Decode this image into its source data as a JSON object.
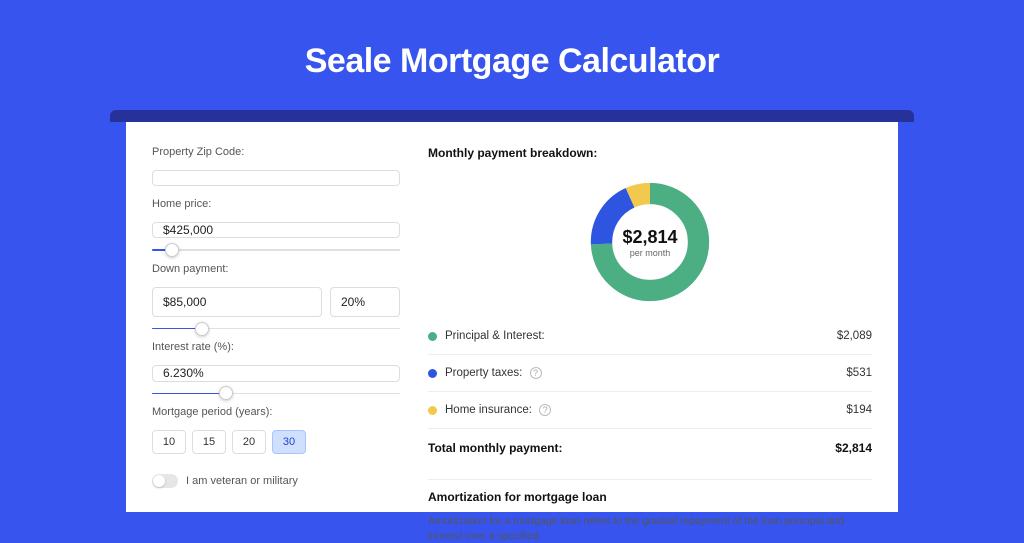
{
  "page_title": "Seale Mortgage Calculator",
  "colors": {
    "accent": "#3755ee",
    "pi": "#4caf83",
    "tax": "#2d55e0",
    "ins": "#f2c94c"
  },
  "form": {
    "zip_label": "Property Zip Code:",
    "zip_value": "",
    "home_price_label": "Home price:",
    "home_price_value": "$425,000",
    "home_price_slider_pct": 8,
    "down_label": "Down payment:",
    "down_value": "$85,000",
    "down_pct_value": "20%",
    "down_slider_pct": 20,
    "rate_label": "Interest rate (%):",
    "rate_value": "6.230%",
    "rate_slider_pct": 30,
    "period_label": "Mortgage period (years):",
    "periods": [
      "10",
      "15",
      "20",
      "30"
    ],
    "period_active_index": 3,
    "veteran_label": "I am veteran or military",
    "veteran_on": false
  },
  "breakdown": {
    "title": "Monthly payment breakdown:",
    "center_value": "$2,814",
    "center_sub": "per month",
    "items": [
      {
        "label": "Principal & Interest:",
        "amount": "$2,089",
        "info": false,
        "color": "g"
      },
      {
        "label": "Property taxes:",
        "amount": "$531",
        "info": true,
        "color": "b"
      },
      {
        "label": "Home insurance:",
        "amount": "$194",
        "info": true,
        "color": "y"
      }
    ],
    "total_label": "Total monthly payment:",
    "total_amount": "$2,814"
  },
  "amort": {
    "title": "Amortization for mortgage loan",
    "desc": "Amortization for a mortgage loan refers to the gradual repayment of the loan principal and interest over a specified"
  },
  "chart_data": {
    "type": "pie",
    "title": "Monthly payment breakdown",
    "series": [
      {
        "name": "Principal & Interest",
        "value": 2089
      },
      {
        "name": "Property taxes",
        "value": 531
      },
      {
        "name": "Home insurance",
        "value": 194
      }
    ],
    "total": 2814,
    "unit": "USD per month"
  }
}
